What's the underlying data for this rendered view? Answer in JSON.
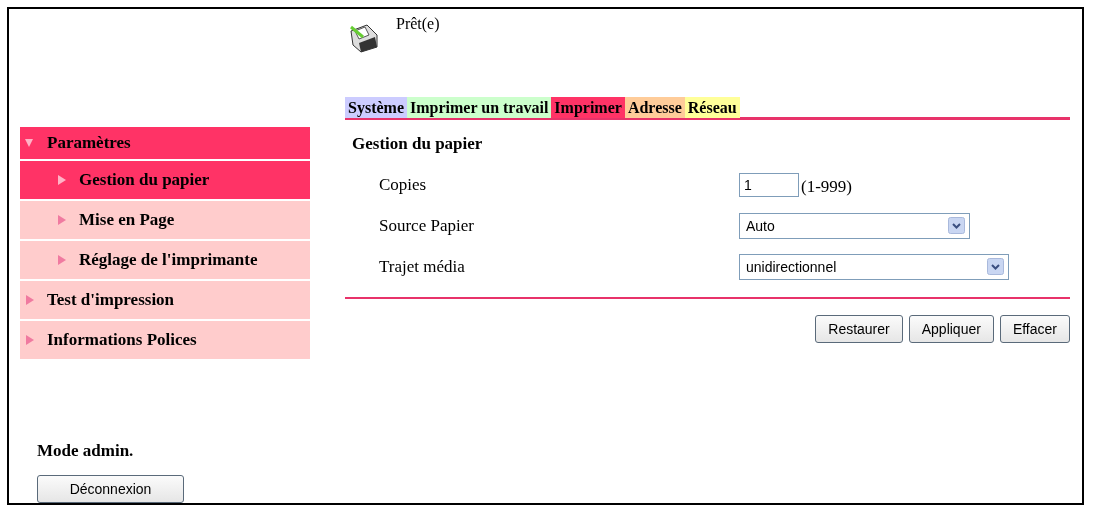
{
  "status": {
    "text": "Prêt(e)"
  },
  "tabs": [
    {
      "label": "Système",
      "color": "#ccccff"
    },
    {
      "label": "Imprimer un travail",
      "color": "#ccffcc"
    },
    {
      "label": "Imprimer",
      "color": "#ff3366"
    },
    {
      "label": "Adresse",
      "color": "#ffcc99"
    },
    {
      "label": "Réseau",
      "color": "#ffff99"
    }
  ],
  "sidebar": {
    "items": [
      {
        "label": "Paramètres",
        "expanded": true,
        "children": [
          {
            "label": "Gestion du papier",
            "selected": true
          },
          {
            "label": "Mise en Page",
            "selected": false
          },
          {
            "label": "Réglage de l'imprimante",
            "selected": false
          }
        ]
      },
      {
        "label": "Test d'impression",
        "expanded": false,
        "selected": false
      },
      {
        "label": "Informations Polices",
        "expanded": false,
        "selected": false
      }
    ]
  },
  "admin": {
    "label": "Mode admin.",
    "button": "Déconnexion"
  },
  "section": {
    "title": "Gestion du papier",
    "fields": [
      {
        "kind": "number",
        "label": "Copies",
        "value": "1",
        "hint": "(1-999)"
      },
      {
        "kind": "select",
        "label": "Source Papier",
        "value": "Auto"
      },
      {
        "kind": "select",
        "label": "Trajet média",
        "value": "unidirectionnel"
      }
    ]
  },
  "buttons": [
    "Restaurer",
    "Appliquer",
    "Effacer"
  ]
}
